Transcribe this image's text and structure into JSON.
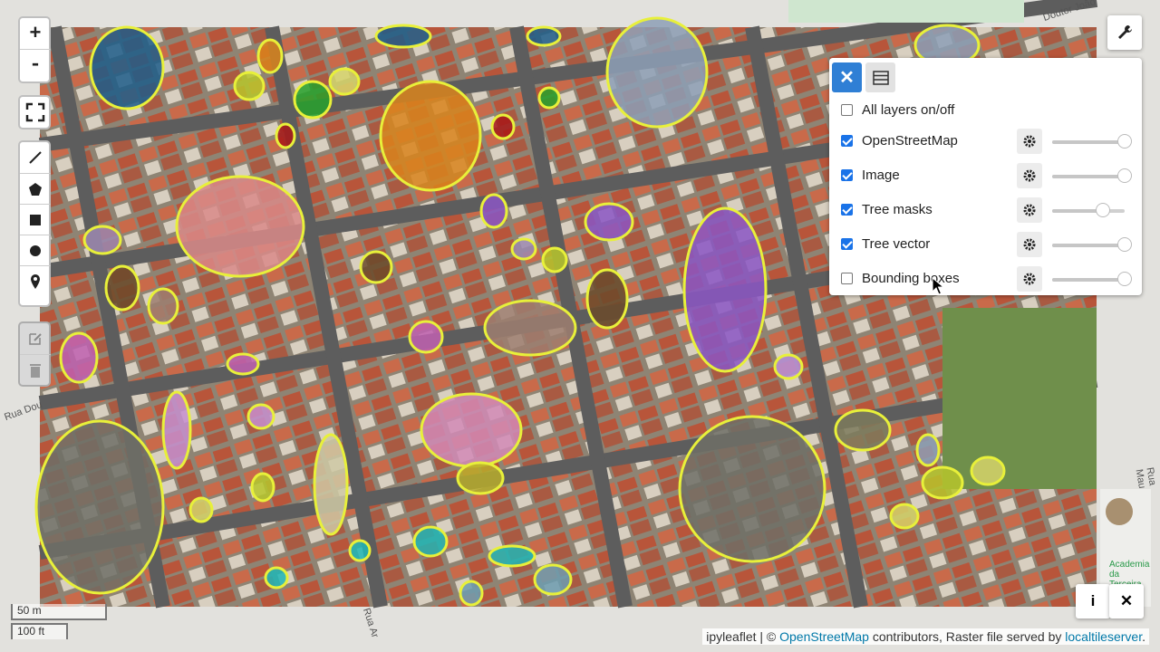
{
  "map": {
    "zoom_in_label": "+",
    "zoom_out_label": "-",
    "fullscreen_icon": "fullscreen-icon",
    "draw_tools": [
      "polyline-icon",
      "polygon-icon",
      "rectangle-icon",
      "circle-icon",
      "marker-icon"
    ],
    "edit_tools": [
      "edit-icon",
      "trash-icon"
    ],
    "street_labels": [
      "Rua Dou",
      "Doutor João",
      "Rua Ar",
      "Academia da Terceira",
      "Rua Mau"
    ]
  },
  "layer_control": {
    "close_label": "✕",
    "toggle_icon": "layers-list-icon",
    "all_layers_label": "All layers on/off",
    "all_layers_checked": false,
    "layers": [
      {
        "name": "OpenStreetMap",
        "checked": true,
        "opacity": 1.0
      },
      {
        "name": "Image",
        "checked": true,
        "opacity": 1.0
      },
      {
        "name": "Tree masks",
        "checked": true,
        "opacity": 0.7
      },
      {
        "name": "Tree vector",
        "checked": true,
        "opacity": 1.0
      },
      {
        "name": "Bounding boxes",
        "checked": false,
        "opacity": 1.0
      }
    ]
  },
  "scale": {
    "metric": "50 m",
    "imperial": "100 ft"
  },
  "attribution": {
    "prefix": "ipyleaflet | © ",
    "osm_link": "OpenStreetMap",
    "middle": " contributors, Raster file served by ",
    "lts_link": "localtileserver",
    "suffix": "."
  },
  "widgets": {
    "info_label": "i",
    "close_label": "✕",
    "wrench_icon": "wrench-icon"
  },
  "colors": {
    "tree_outline": "#e8f03a",
    "accent": "#2f7fd5"
  }
}
